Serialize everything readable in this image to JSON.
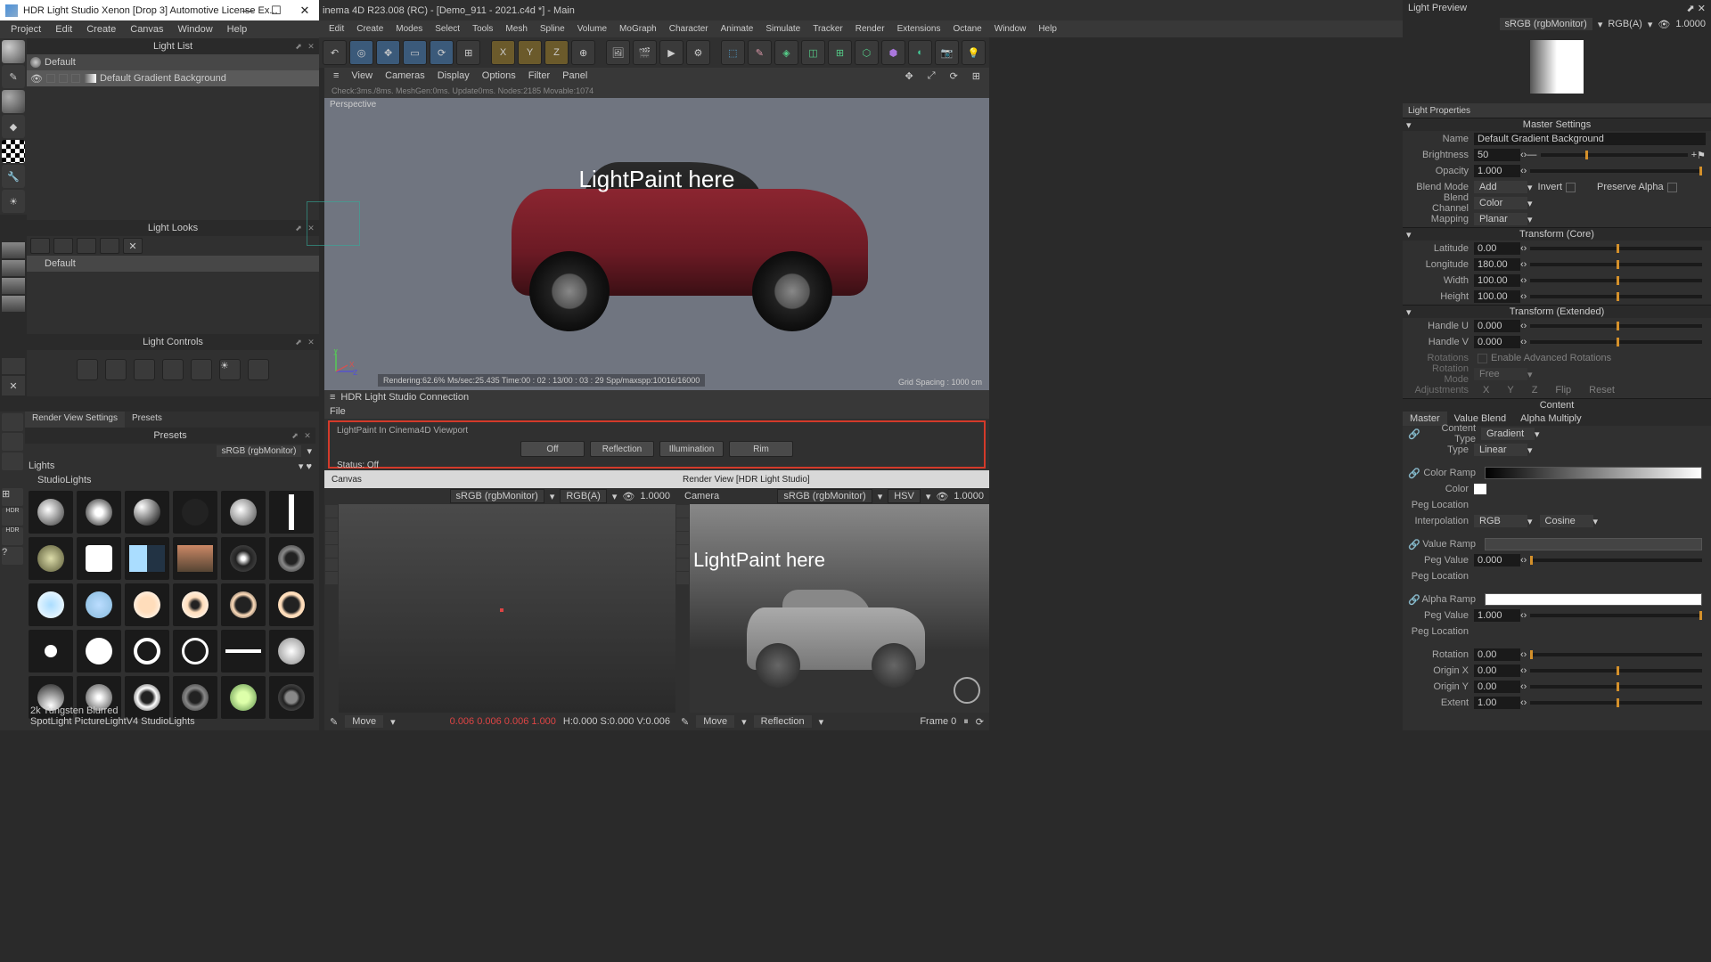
{
  "hdrls": {
    "title": "HDR Light Studio Xenon [Drop 3] Automotive License Ex...",
    "menu": [
      "Project",
      "Edit",
      "Create",
      "Canvas",
      "Window",
      "Help"
    ],
    "lightList": {
      "title": "Light List",
      "default": "Default",
      "item": "Default Gradient Background"
    },
    "lightLooks": {
      "title": "Light Looks",
      "default": "Default"
    },
    "lightControls": {
      "title": "Light Controls"
    }
  },
  "c4d": {
    "title": "inema 4D R23.008 (RC) - [Demo_911 - 2021.c4d *] - Main",
    "menu": [
      "Edit",
      "Create",
      "Modes",
      "Select",
      "Tools",
      "Mesh",
      "Spline",
      "Volume",
      "MoGraph",
      "Character",
      "Animate",
      "Simulate",
      "Tracker",
      "Render",
      "Extensions",
      "Octane",
      "Window",
      "Help"
    ],
    "viewport": {
      "menu": [
        "View",
        "Cameras",
        "Display",
        "Options",
        "Filter",
        "Panel"
      ],
      "persp": "Perspective",
      "stats": "Check:3ms./8ms. MeshGen:0ms. Update0ms. Nodes:2185 Movable:1074",
      "overlay": "LightPaint here",
      "renderStatus": "Rendering:62.6% Ms/sec:25.435 Time:00 : 02 : 13/00 : 03 : 29 Spp/maxspp:10016/16000",
      "gridSpacing": "Grid Spacing : 1000 cm"
    },
    "connection": {
      "title": "HDR Light Studio Connection",
      "file": "File",
      "lpTitle": "LightPaint In Cinema4D Viewport",
      "btns": [
        "Off",
        "Reflection",
        "Illumination",
        "Rim"
      ],
      "status": "Status: Off"
    },
    "canvas": {
      "title": "Canvas",
      "srgb": "sRGB (rgbMonitor)",
      "rgba": "RGB(A)",
      "val": "1.0000"
    },
    "renderView": {
      "title": "Render View [HDR Light Studio]",
      "cam": "Camera",
      "srgb": "sRGB (rgbMonitor)",
      "hsv": "HSV",
      "val": "1.0000",
      "overlay": "LightPaint here"
    },
    "bottom": {
      "move": "Move",
      "vals": "0.006 0.006 0.006 1.000",
      "hsv": "H:0.000 S:0.000 V:0.006",
      "refl": "Reflection",
      "frame": "Frame 0"
    }
  },
  "presets": {
    "tabs": [
      "Render View Settings",
      "Presets"
    ],
    "title": "Presets",
    "srgb": "sRGB (rgbMonitor)",
    "lights": "Lights",
    "studio": "StudioLights",
    "footer1": "2k Tungsten Blurred",
    "footer2": "SpotLight PictureLightV4 StudioLights"
  },
  "right": {
    "preview": {
      "title": "Light Preview",
      "srgb": "sRGB (rgbMonitor)",
      "rgba": "RGB(A)",
      "val": "1.0000"
    },
    "props": {
      "title": "Light Properties"
    },
    "master": {
      "title": "Master Settings",
      "name": {
        "label": "Name",
        "val": "Default Gradient Background"
      },
      "brightness": {
        "label": "Brightness",
        "val": "50"
      },
      "opacity": {
        "label": "Opacity",
        "val": "1.000"
      },
      "blendMode": {
        "label": "Blend Mode",
        "val": "Add",
        "invert": "Invert",
        "preserve": "Preserve Alpha"
      },
      "blendChannel": {
        "label": "Blend Channel",
        "val": "Color"
      },
      "mapping": {
        "label": "Mapping",
        "val": "Planar"
      }
    },
    "transformCore": {
      "title": "Transform (Core)",
      "lat": {
        "label": "Latitude",
        "val": "0.00"
      },
      "lon": {
        "label": "Longitude",
        "val": "180.00"
      },
      "w": {
        "label": "Width",
        "val": "100.00"
      },
      "h": {
        "label": "Height",
        "val": "100.00"
      }
    },
    "transformExt": {
      "title": "Transform (Extended)",
      "hu": {
        "label": "Handle U",
        "val": "0.000"
      },
      "hv": {
        "label": "Handle V",
        "val": "0.000"
      },
      "rot": {
        "label": "Rotations",
        "enable": "Enable Advanced Rotations"
      },
      "rotMode": {
        "label": "Rotation Mode",
        "val": "Free"
      },
      "adj": {
        "label": "Adjustments",
        "x": "X",
        "y": "Y",
        "z": "Z",
        "flip": "Flip",
        "reset": "Reset"
      }
    },
    "content": {
      "title": "Content",
      "tabs": [
        "Master",
        "Value Blend",
        "Alpha Multiply"
      ],
      "type": {
        "label": "Content Type",
        "val": "Gradient"
      },
      "type2": {
        "label": "Type",
        "val": "Linear"
      },
      "colorRamp": "Color Ramp",
      "color": "Color",
      "pegLoc": "Peg Location",
      "interp": {
        "label": "Interpolation",
        "val": "RGB",
        "val2": "Cosine"
      },
      "valueRamp": "Value Ramp",
      "pegVal": {
        "label": "Peg Value",
        "val": "0.000"
      },
      "alphaRamp": "Alpha Ramp",
      "pegVal2": {
        "label": "Peg Value",
        "val": "1.000"
      },
      "rotation": {
        "label": "Rotation",
        "val": "0.00"
      },
      "ox": {
        "label": "Origin X",
        "val": "0.00"
      },
      "oy": {
        "label": "Origin Y",
        "val": "0.00"
      },
      "extent": {
        "label": "Extent",
        "val": "1.00"
      }
    }
  }
}
